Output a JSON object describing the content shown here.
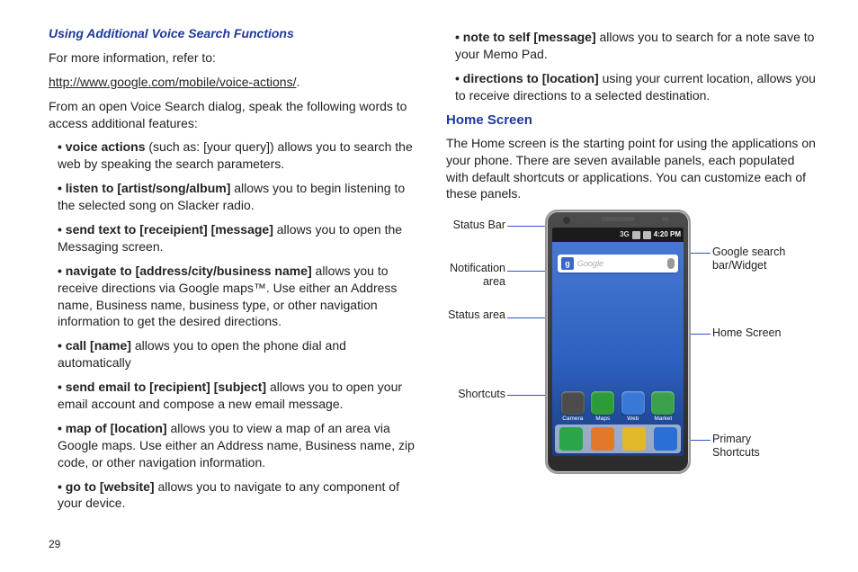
{
  "page_number": "29",
  "left": {
    "heading": "Using Additional Voice Search Functions",
    "intro": "For more information, refer to:",
    "link_text": "http://www.google.com/mobile/voice-actions/",
    "after_link": ".",
    "instruct": "From an open Voice Search dialog, speak the following words to access additional features:",
    "items": [
      {
        "term": "voice actions",
        "rest": " (such as: [your query]) allows you to search the web by speaking the search parameters."
      },
      {
        "term": "listen to [artist/song/album]",
        "rest": " allows you to begin listening to the selected song on Slacker radio."
      },
      {
        "term": "send text to [receipient] [message]",
        "rest": " allows you to open the Messaging screen."
      },
      {
        "term": "navigate to [address/city/business name]",
        "rest": " allows you to receive directions via Google maps™. Use either an Address name, Business name, business type, or other navigation information to get the desired directions."
      },
      {
        "term": "call [name]",
        "rest": " allows you to open the phone dial and automatically"
      },
      {
        "term": "send email to [recipient] [subject]",
        "rest": " allows you to open your email account and compose a new email message."
      },
      {
        "term": "map of [location]",
        "rest": " allows you to view a map of an area via Google maps. Use either an Address name, Business name, zip code, or other navigation information."
      },
      {
        "term": "go to [website]",
        "rest": " allows you to navigate to any component of your device."
      }
    ]
  },
  "right": {
    "items": [
      {
        "term": "note to self [message]",
        "rest": " allows you to search for a note save to your Memo Pad."
      },
      {
        "term": "directions to [location]",
        "rest": " using your current location, allows you to receive directions to a selected destination."
      }
    ],
    "heading": "Home Screen",
    "body": "The Home screen is the starting point for using the applications on your phone. There are seven available panels, each populated with default shortcuts or applications. You can customize each of these panels."
  },
  "diagram": {
    "labels_left": {
      "status_bar": "Status Bar",
      "notification_area": "Notification area",
      "status_area": "Status area",
      "shortcuts": "Shortcuts"
    },
    "labels_right": {
      "search": "Google search bar/Widget",
      "home": "Home Screen",
      "primary": "Primary Shortcuts"
    },
    "status_time": "4:20 PM",
    "status_net": "3G",
    "search_placeholder": "Google",
    "shortcut_apps": [
      {
        "label": "Camera",
        "color": "#4c4c4c"
      },
      {
        "label": "Maps",
        "color": "#2e9b3a"
      },
      {
        "label": "Web",
        "color": "#3a78d6"
      },
      {
        "label": "Market",
        "color": "#3aa04a"
      }
    ],
    "primary_colors": [
      "#2aa54a",
      "#e07a2a",
      "#e0b82a",
      "#2a6fd6"
    ]
  }
}
